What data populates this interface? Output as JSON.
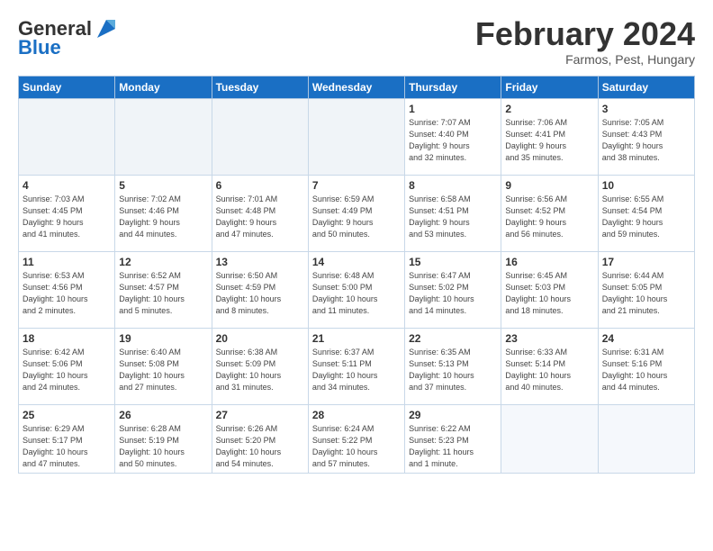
{
  "header": {
    "logo_text_general": "General",
    "logo_text_blue": "Blue",
    "month_title": "February 2024",
    "location": "Farmos, Pest, Hungary"
  },
  "days_of_week": [
    "Sunday",
    "Monday",
    "Tuesday",
    "Wednesday",
    "Thursday",
    "Friday",
    "Saturday"
  ],
  "weeks": [
    [
      {
        "day": "",
        "info": ""
      },
      {
        "day": "",
        "info": ""
      },
      {
        "day": "",
        "info": ""
      },
      {
        "day": "",
        "info": ""
      },
      {
        "day": "1",
        "info": "Sunrise: 7:07 AM\nSunset: 4:40 PM\nDaylight: 9 hours\nand 32 minutes."
      },
      {
        "day": "2",
        "info": "Sunrise: 7:06 AM\nSunset: 4:41 PM\nDaylight: 9 hours\nand 35 minutes."
      },
      {
        "day": "3",
        "info": "Sunrise: 7:05 AM\nSunset: 4:43 PM\nDaylight: 9 hours\nand 38 minutes."
      }
    ],
    [
      {
        "day": "4",
        "info": "Sunrise: 7:03 AM\nSunset: 4:45 PM\nDaylight: 9 hours\nand 41 minutes."
      },
      {
        "day": "5",
        "info": "Sunrise: 7:02 AM\nSunset: 4:46 PM\nDaylight: 9 hours\nand 44 minutes."
      },
      {
        "day": "6",
        "info": "Sunrise: 7:01 AM\nSunset: 4:48 PM\nDaylight: 9 hours\nand 47 minutes."
      },
      {
        "day": "7",
        "info": "Sunrise: 6:59 AM\nSunset: 4:49 PM\nDaylight: 9 hours\nand 50 minutes."
      },
      {
        "day": "8",
        "info": "Sunrise: 6:58 AM\nSunset: 4:51 PM\nDaylight: 9 hours\nand 53 minutes."
      },
      {
        "day": "9",
        "info": "Sunrise: 6:56 AM\nSunset: 4:52 PM\nDaylight: 9 hours\nand 56 minutes."
      },
      {
        "day": "10",
        "info": "Sunrise: 6:55 AM\nSunset: 4:54 PM\nDaylight: 9 hours\nand 59 minutes."
      }
    ],
    [
      {
        "day": "11",
        "info": "Sunrise: 6:53 AM\nSunset: 4:56 PM\nDaylight: 10 hours\nand 2 minutes."
      },
      {
        "day": "12",
        "info": "Sunrise: 6:52 AM\nSunset: 4:57 PM\nDaylight: 10 hours\nand 5 minutes."
      },
      {
        "day": "13",
        "info": "Sunrise: 6:50 AM\nSunset: 4:59 PM\nDaylight: 10 hours\nand 8 minutes."
      },
      {
        "day": "14",
        "info": "Sunrise: 6:48 AM\nSunset: 5:00 PM\nDaylight: 10 hours\nand 11 minutes."
      },
      {
        "day": "15",
        "info": "Sunrise: 6:47 AM\nSunset: 5:02 PM\nDaylight: 10 hours\nand 14 minutes."
      },
      {
        "day": "16",
        "info": "Sunrise: 6:45 AM\nSunset: 5:03 PM\nDaylight: 10 hours\nand 18 minutes."
      },
      {
        "day": "17",
        "info": "Sunrise: 6:44 AM\nSunset: 5:05 PM\nDaylight: 10 hours\nand 21 minutes."
      }
    ],
    [
      {
        "day": "18",
        "info": "Sunrise: 6:42 AM\nSunset: 5:06 PM\nDaylight: 10 hours\nand 24 minutes."
      },
      {
        "day": "19",
        "info": "Sunrise: 6:40 AM\nSunset: 5:08 PM\nDaylight: 10 hours\nand 27 minutes."
      },
      {
        "day": "20",
        "info": "Sunrise: 6:38 AM\nSunset: 5:09 PM\nDaylight: 10 hours\nand 31 minutes."
      },
      {
        "day": "21",
        "info": "Sunrise: 6:37 AM\nSunset: 5:11 PM\nDaylight: 10 hours\nand 34 minutes."
      },
      {
        "day": "22",
        "info": "Sunrise: 6:35 AM\nSunset: 5:13 PM\nDaylight: 10 hours\nand 37 minutes."
      },
      {
        "day": "23",
        "info": "Sunrise: 6:33 AM\nSunset: 5:14 PM\nDaylight: 10 hours\nand 40 minutes."
      },
      {
        "day": "24",
        "info": "Sunrise: 6:31 AM\nSunset: 5:16 PM\nDaylight: 10 hours\nand 44 minutes."
      }
    ],
    [
      {
        "day": "25",
        "info": "Sunrise: 6:29 AM\nSunset: 5:17 PM\nDaylight: 10 hours\nand 47 minutes."
      },
      {
        "day": "26",
        "info": "Sunrise: 6:28 AM\nSunset: 5:19 PM\nDaylight: 10 hours\nand 50 minutes."
      },
      {
        "day": "27",
        "info": "Sunrise: 6:26 AM\nSunset: 5:20 PM\nDaylight: 10 hours\nand 54 minutes."
      },
      {
        "day": "28",
        "info": "Sunrise: 6:24 AM\nSunset: 5:22 PM\nDaylight: 10 hours\nand 57 minutes."
      },
      {
        "day": "29",
        "info": "Sunrise: 6:22 AM\nSunset: 5:23 PM\nDaylight: 11 hours\nand 1 minute."
      },
      {
        "day": "",
        "info": ""
      },
      {
        "day": "",
        "info": ""
      }
    ]
  ]
}
